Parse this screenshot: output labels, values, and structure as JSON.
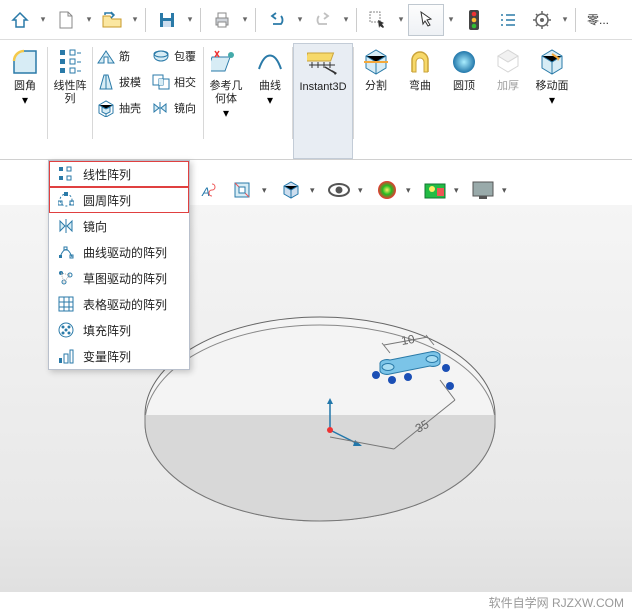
{
  "topbar": {
    "combo_text": "零..."
  },
  "ribbon": {
    "fillet": "圆角",
    "linpat": "线性阵\n列",
    "rib": "筋",
    "draft": "拔模",
    "shell": "抽壳",
    "wrap": "包覆",
    "intersect": "相交",
    "mirror": "镜向",
    "refgeom": "参考几\n何体",
    "curve": "曲线",
    "instant3d": "Instant3D",
    "split": "分割",
    "bend": "弯曲",
    "dome": "圆顶",
    "thicken": "加厚",
    "moveface": "移动面"
  },
  "menu": {
    "items": [
      "线性阵列",
      "圆周阵列",
      "镜向",
      "曲线驱动的阵列",
      "草图驱动的阵列",
      "表格驱动的阵列",
      "填充阵列",
      "变量阵列"
    ]
  },
  "model": {
    "dim_short": "10",
    "dim_long": "35"
  },
  "footer": {
    "credit": "软件自学网  RJZXW.COM"
  }
}
